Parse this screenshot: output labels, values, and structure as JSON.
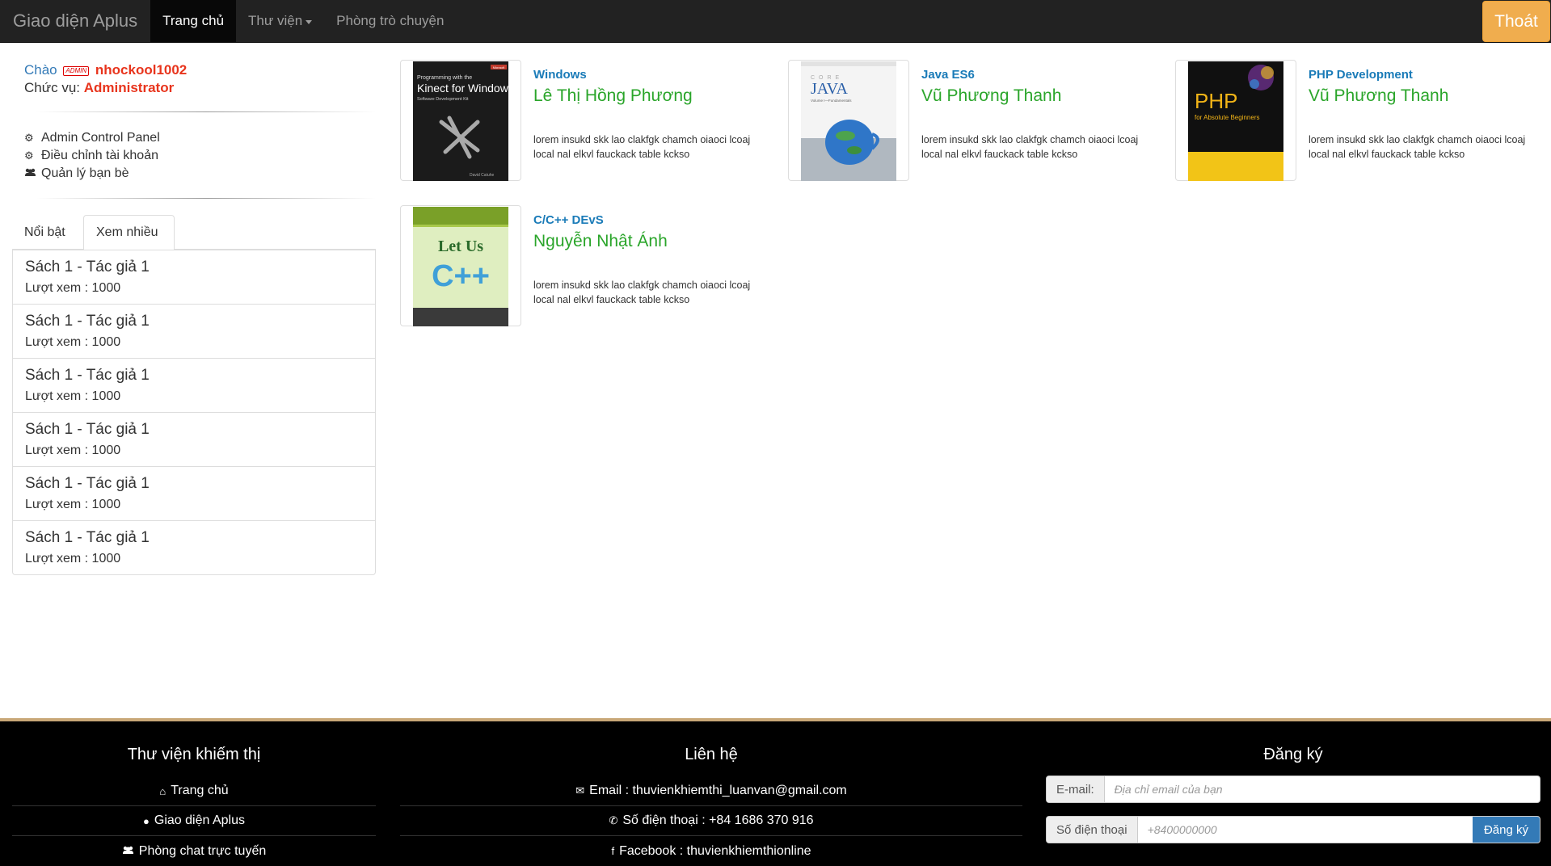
{
  "navbar": {
    "brand": "Giao diện Aplus",
    "items": [
      {
        "label": "Trang chủ"
      },
      {
        "label": "Thư viện"
      },
      {
        "label": "Phòng trò chuyện"
      }
    ],
    "logout": "Thoát"
  },
  "user": {
    "greeting": "Chào",
    "badge": "ADMIN",
    "username": "nhockool1002",
    "role_label": "Chức vụ:",
    "role": "Administrator"
  },
  "menu": [
    {
      "label": "Admin Control Panel",
      "icon": "gears-icon"
    },
    {
      "label": "Điều chỉnh tài khoản",
      "icon": "gears-icon"
    },
    {
      "label": "Quản lý bạn bè",
      "icon": "users-icon"
    }
  ],
  "tabs": [
    {
      "label": "Nổi bật"
    },
    {
      "label": "Xem nhiều"
    }
  ],
  "list": [
    {
      "title": "Sách 1 - Tác giả 1",
      "views": "Lượt xem : 1000"
    },
    {
      "title": "Sách 1 - Tác giả 1",
      "views": "Lượt xem : 1000"
    },
    {
      "title": "Sách 1 - Tác giả 1",
      "views": "Lượt xem : 1000"
    },
    {
      "title": "Sách 1 - Tác giả 1",
      "views": "Lượt xem : 1000"
    },
    {
      "title": "Sách 1 - Tác giả 1",
      "views": "Lượt xem : 1000"
    },
    {
      "title": "Sách 1 - Tác giả 1",
      "views": "Lượt xem : 1000"
    }
  ],
  "books": [
    {
      "category": "Windows",
      "author": "Lê Thị Hồng Phương",
      "desc": "lorem insukd skk lao clakfgk chamch oiaoci lcoaj local nal elkvl fauckack table kckso",
      "cover_title": "Kinect for Windows",
      "cover_pre": "Programming with the",
      "cover_sub": "Software Development Kit",
      "cover_author": "David Catuhe",
      "cover_brand": "Microsoft"
    },
    {
      "category": "Java ES6",
      "author": "Vũ Phương Thanh",
      "desc": "lorem insukd skk lao clakfgk chamch oiaoci lcoaj local nal elkvl fauckack table kckso",
      "cover_title": "JAVA",
      "cover_pre": "CORE",
      "cover_sub": "Volume I—Fundamentals"
    },
    {
      "category": "PHP Development",
      "author": "Vũ Phương Thanh",
      "desc": "lorem insukd skk lao clakfgk chamch oiaoci lcoaj local nal elkvl fauckack table kckso",
      "cover_title": "PHP",
      "cover_sub": "for Absolute Beginners"
    },
    {
      "category": "C/C++ DEvS",
      "author": "Nguyễn Nhật Ánh",
      "desc": "lorem insukd skk lao clakfgk chamch oiaoci lcoaj local nal elkvl fauckack table kckso",
      "cover_title": "Let Us",
      "cover_sub": "C++"
    }
  ],
  "footer": {
    "col1": {
      "title": "Thư viện khiếm thị",
      "links": [
        {
          "label": "Trang chủ",
          "icon": "home-icon"
        },
        {
          "label": "Giao diện Aplus",
          "icon": "circle-icon"
        },
        {
          "label": "Phòng chat trực tuyến",
          "icon": "users-icon"
        }
      ]
    },
    "col2": {
      "title": "Liên hệ",
      "email": "Email : thuvienkhiemthi_luanvan@gmail.com",
      "phone": "Số điện thoại : +84 1686 370 916",
      "facebook": "Facebook : thuvienkhiemthionline"
    },
    "col3": {
      "title": "Đăng ký",
      "email_label": "E-mail:",
      "email_placeholder": "Địa chỉ email của bạn",
      "phone_label": "Số điện thoại",
      "phone_placeholder": "+8400000000",
      "submit": "Đăng ký"
    }
  }
}
